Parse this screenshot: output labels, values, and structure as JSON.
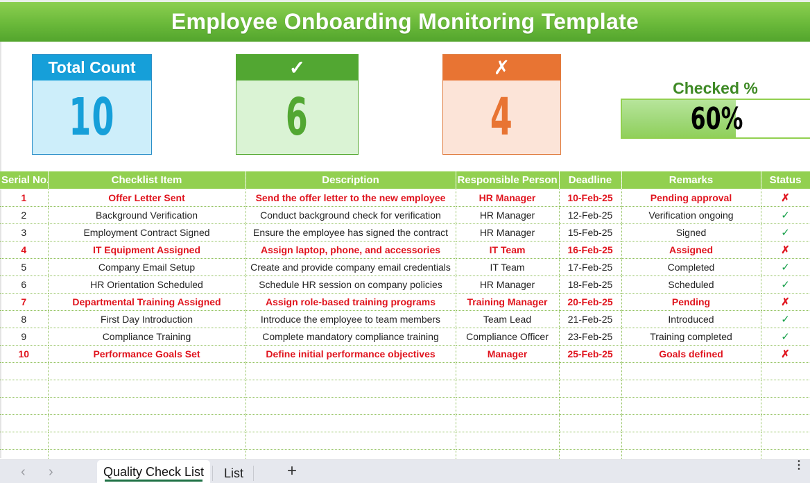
{
  "title": "Employee Onboarding Monitoring Template",
  "cards": {
    "total": {
      "label": "Total Count",
      "value": "10",
      "color": "#169fd9"
    },
    "checked": {
      "label": "✓",
      "value": "6",
      "color": "#52a732"
    },
    "unchecked": {
      "label": "✗",
      "value": "4",
      "color": "#e87433"
    }
  },
  "progress": {
    "label": "Checked %",
    "value_text": "60%",
    "fraction": 0.6
  },
  "table": {
    "columns": [
      "Serial No.",
      "Checklist Item",
      "Description",
      "Responsible Person",
      "Deadline",
      "Remarks",
      "Status"
    ],
    "rows": [
      {
        "serial": "1",
        "item": "Offer Letter Sent",
        "description": "Send the offer letter to the new employee",
        "person": "HR Manager",
        "deadline": "10-Feb-25",
        "remarks": "Pending approval",
        "status": "✗",
        "checked": false
      },
      {
        "serial": "2",
        "item": "Background Verification",
        "description": "Conduct background check for verification",
        "person": "HR Manager",
        "deadline": "12-Feb-25",
        "remarks": "Verification ongoing",
        "status": "✓",
        "checked": true
      },
      {
        "serial": "3",
        "item": "Employment Contract Signed",
        "description": "Ensure the employee has signed the contract",
        "person": "HR Manager",
        "deadline": "15-Feb-25",
        "remarks": "Signed",
        "status": "✓",
        "checked": true
      },
      {
        "serial": "4",
        "item": "IT Equipment Assigned",
        "description": "Assign laptop, phone, and accessories",
        "person": "IT Team",
        "deadline": "16-Feb-25",
        "remarks": "Assigned",
        "status": "✗",
        "checked": false
      },
      {
        "serial": "5",
        "item": "Company Email Setup",
        "description": "Create and provide company email credentials",
        "person": "IT Team",
        "deadline": "17-Feb-25",
        "remarks": "Completed",
        "status": "✓",
        "checked": true
      },
      {
        "serial": "6",
        "item": "HR Orientation Scheduled",
        "description": "Schedule HR session on company policies",
        "person": "HR Manager",
        "deadline": "18-Feb-25",
        "remarks": "Scheduled",
        "status": "✓",
        "checked": true
      },
      {
        "serial": "7",
        "item": "Departmental Training Assigned",
        "description": "Assign role-based training programs",
        "person": "Training Manager",
        "deadline": "20-Feb-25",
        "remarks": "Pending",
        "status": "✗",
        "checked": false
      },
      {
        "serial": "8",
        "item": "First Day Introduction",
        "description": "Introduce the employee to team members",
        "person": "Team Lead",
        "deadline": "21-Feb-25",
        "remarks": "Introduced",
        "status": "✓",
        "checked": true
      },
      {
        "serial": "9",
        "item": "Compliance Training",
        "description": "Complete mandatory compliance training",
        "person": "Compliance Officer",
        "deadline": "23-Feb-25",
        "remarks": "Training completed",
        "status": "✓",
        "checked": true
      },
      {
        "serial": "10",
        "item": "Performance Goals Set",
        "description": "Define initial performance objectives",
        "person": "Manager",
        "deadline": "25-Feb-25",
        "remarks": "Goals defined",
        "status": "✗",
        "checked": false
      }
    ]
  },
  "sheet_tabs": {
    "prev_icon": "‹",
    "next_icon": "›",
    "tabs": [
      "Quality Check List",
      "List"
    ],
    "active": "Quality Check List",
    "add_icon": "+",
    "more_icon": "⋮"
  }
}
